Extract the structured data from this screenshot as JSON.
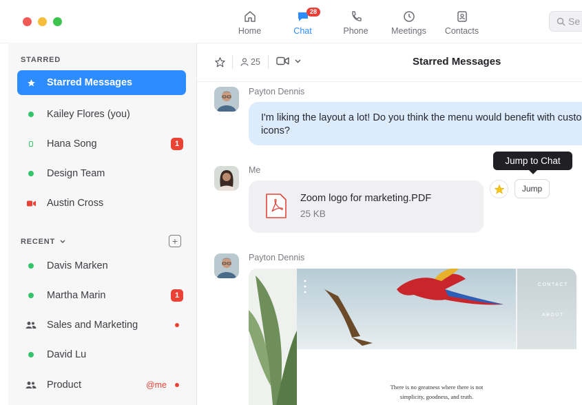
{
  "nav": {
    "items": [
      {
        "label": "Home",
        "icon": "home-icon"
      },
      {
        "label": "Chat",
        "icon": "chat-icon",
        "badge": "28"
      },
      {
        "label": "Phone",
        "icon": "phone-icon"
      },
      {
        "label": "Meetings",
        "icon": "clock-icon"
      },
      {
        "label": "Contacts",
        "icon": "contacts-icon"
      }
    ],
    "search_placeholder": "Se"
  },
  "sidebar": {
    "starred_label": "STARRED",
    "recent_label": "RECENT",
    "starred": [
      {
        "label": "Starred Messages"
      },
      {
        "label": "Kailey Flores  (you)"
      },
      {
        "label": "Hana Song",
        "badge": "1"
      },
      {
        "label": "Design Team"
      },
      {
        "label": "Austin Cross"
      }
    ],
    "recent": [
      {
        "label": "Davis Marken"
      },
      {
        "label": "Martha Marin",
        "badge": "1"
      },
      {
        "label": "Sales and Marketing"
      },
      {
        "label": "David Lu"
      },
      {
        "label": "Product",
        "mention": "@me"
      }
    ]
  },
  "chat": {
    "title": "Starred Messages",
    "member_count": "25",
    "messages": [
      {
        "sender": "Payton Dennis",
        "text": "I'm liking the layout a lot! Do you think the menu would benefit with custom icons?"
      },
      {
        "sender": "Me",
        "file_name": "Zoom logo for marketing.PDF",
        "file_size": "25 KB"
      },
      {
        "sender": "Payton Dennis"
      }
    ],
    "tooltip": "Jump to Chat",
    "jump_label": "Jump",
    "preview": {
      "nav_contact": "CONTACT",
      "nav_about": "ABOUT",
      "quote_line1": "There is no greatness where there is not",
      "quote_line2": "simplicity, goodness, and truth."
    }
  },
  "colors": {
    "accent": "#2d8cff",
    "badge": "#ea4335",
    "online": "#35c46b"
  }
}
